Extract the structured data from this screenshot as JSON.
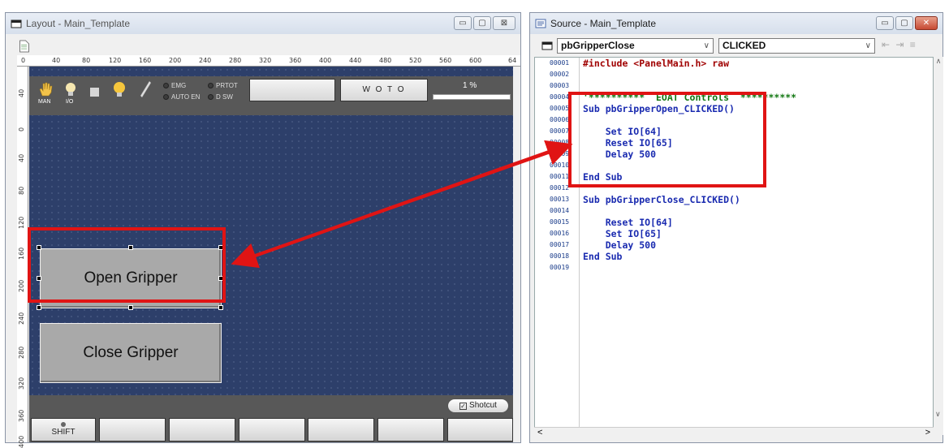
{
  "layout_window": {
    "title": "Layout - Main_Template",
    "controls": [
      "▭",
      "▢",
      "⊠"
    ]
  },
  "ruler": {
    "top": [
      "0",
      "40",
      "80",
      "120",
      "160",
      "200",
      "240",
      "280",
      "320",
      "360",
      "400",
      "440",
      "480",
      "520",
      "560",
      "600",
      "64"
    ],
    "left": [
      "40",
      "0",
      "40",
      "80",
      "120",
      "160",
      "200",
      "240",
      "280",
      "320",
      "360",
      "400"
    ]
  },
  "panel": {
    "header": {
      "man_label": "MAN",
      "io_label": "I/O",
      "emg_label": "EMG",
      "prtot_label": "PRTOT",
      "auto_en_label": "AUTO EN",
      "dsw_label": "D SW",
      "blank_button": "",
      "woto_label": "W O T O",
      "percent_label": "1  %",
      "progress_value": 0
    },
    "open_gripper_label": "Open Gripper",
    "close_gripper_label": "Close Gripper",
    "shotcut_label": "Shotcut",
    "shift_label": "SHIFT",
    "function_keys": [
      "",
      "",
      "",
      "",
      "",
      ""
    ]
  },
  "source_window": {
    "title": "Source - Main_Template",
    "object_combo": "pbGripperClose",
    "event_combo": "CLICKED",
    "lines": [
      {
        "num": "00001",
        "text": "#include <PanelMain.h> raw"
      },
      {
        "num": "00002",
        "text": ""
      },
      {
        "num": "00003",
        "text": ""
      },
      {
        "num": "00004",
        "text": "'**********  EOAT Controls  **********"
      },
      {
        "num": "00005",
        "text": "Sub pbGripperOpen_CLICKED()"
      },
      {
        "num": "00006",
        "text": ""
      },
      {
        "num": "00007",
        "text": "    Set IO[64]"
      },
      {
        "num": "00008",
        "text": "    Reset IO[65]"
      },
      {
        "num": "00009",
        "text": "    Delay 500"
      },
      {
        "num": "00010",
        "text": ""
      },
      {
        "num": "00011",
        "text": "End Sub"
      },
      {
        "num": "00012",
        "text": ""
      },
      {
        "num": "00013",
        "text": "Sub pbGripperClose_CLICKED()"
      },
      {
        "num": "00014",
        "text": ""
      },
      {
        "num": "00015",
        "text": "    Reset IO[64]"
      },
      {
        "num": "00016",
        "text": "    Set IO[65]"
      },
      {
        "num": "00017",
        "text": "    Delay 500"
      },
      {
        "num": "00018",
        "text": "End Sub"
      },
      {
        "num": "00019",
        "text": ""
      }
    ]
  },
  "colors": {
    "annotation_red": "#e01414",
    "panel_blue": "#2d3f6a",
    "bar_gray": "#585858"
  }
}
